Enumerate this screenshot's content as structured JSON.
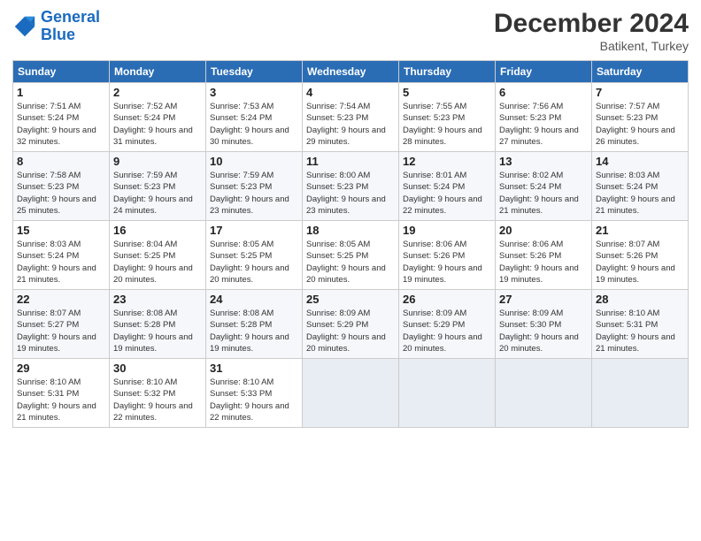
{
  "logo": {
    "line1": "General",
    "line2": "Blue"
  },
  "title": "December 2024",
  "location": "Batikent, Turkey",
  "days_header": [
    "Sunday",
    "Monday",
    "Tuesday",
    "Wednesday",
    "Thursday",
    "Friday",
    "Saturday"
  ],
  "weeks": [
    [
      {
        "day": "1",
        "sunrise": "Sunrise: 7:51 AM",
        "sunset": "Sunset: 5:24 PM",
        "daylight": "Daylight: 9 hours and 32 minutes."
      },
      {
        "day": "2",
        "sunrise": "Sunrise: 7:52 AM",
        "sunset": "Sunset: 5:24 PM",
        "daylight": "Daylight: 9 hours and 31 minutes."
      },
      {
        "day": "3",
        "sunrise": "Sunrise: 7:53 AM",
        "sunset": "Sunset: 5:24 PM",
        "daylight": "Daylight: 9 hours and 30 minutes."
      },
      {
        "day": "4",
        "sunrise": "Sunrise: 7:54 AM",
        "sunset": "Sunset: 5:23 PM",
        "daylight": "Daylight: 9 hours and 29 minutes."
      },
      {
        "day": "5",
        "sunrise": "Sunrise: 7:55 AM",
        "sunset": "Sunset: 5:23 PM",
        "daylight": "Daylight: 9 hours and 28 minutes."
      },
      {
        "day": "6",
        "sunrise": "Sunrise: 7:56 AM",
        "sunset": "Sunset: 5:23 PM",
        "daylight": "Daylight: 9 hours and 27 minutes."
      },
      {
        "day": "7",
        "sunrise": "Sunrise: 7:57 AM",
        "sunset": "Sunset: 5:23 PM",
        "daylight": "Daylight: 9 hours and 26 minutes."
      }
    ],
    [
      {
        "day": "8",
        "sunrise": "Sunrise: 7:58 AM",
        "sunset": "Sunset: 5:23 PM",
        "daylight": "Daylight: 9 hours and 25 minutes."
      },
      {
        "day": "9",
        "sunrise": "Sunrise: 7:59 AM",
        "sunset": "Sunset: 5:23 PM",
        "daylight": "Daylight: 9 hours and 24 minutes."
      },
      {
        "day": "10",
        "sunrise": "Sunrise: 7:59 AM",
        "sunset": "Sunset: 5:23 PM",
        "daylight": "Daylight: 9 hours and 23 minutes."
      },
      {
        "day": "11",
        "sunrise": "Sunrise: 8:00 AM",
        "sunset": "Sunset: 5:23 PM",
        "daylight": "Daylight: 9 hours and 23 minutes."
      },
      {
        "day": "12",
        "sunrise": "Sunrise: 8:01 AM",
        "sunset": "Sunset: 5:24 PM",
        "daylight": "Daylight: 9 hours and 22 minutes."
      },
      {
        "day": "13",
        "sunrise": "Sunrise: 8:02 AM",
        "sunset": "Sunset: 5:24 PM",
        "daylight": "Daylight: 9 hours and 21 minutes."
      },
      {
        "day": "14",
        "sunrise": "Sunrise: 8:03 AM",
        "sunset": "Sunset: 5:24 PM",
        "daylight": "Daylight: 9 hours and 21 minutes."
      }
    ],
    [
      {
        "day": "15",
        "sunrise": "Sunrise: 8:03 AM",
        "sunset": "Sunset: 5:24 PM",
        "daylight": "Daylight: 9 hours and 21 minutes."
      },
      {
        "day": "16",
        "sunrise": "Sunrise: 8:04 AM",
        "sunset": "Sunset: 5:25 PM",
        "daylight": "Daylight: 9 hours and 20 minutes."
      },
      {
        "day": "17",
        "sunrise": "Sunrise: 8:05 AM",
        "sunset": "Sunset: 5:25 PM",
        "daylight": "Daylight: 9 hours and 20 minutes."
      },
      {
        "day": "18",
        "sunrise": "Sunrise: 8:05 AM",
        "sunset": "Sunset: 5:25 PM",
        "daylight": "Daylight: 9 hours and 20 minutes."
      },
      {
        "day": "19",
        "sunrise": "Sunrise: 8:06 AM",
        "sunset": "Sunset: 5:26 PM",
        "daylight": "Daylight: 9 hours and 19 minutes."
      },
      {
        "day": "20",
        "sunrise": "Sunrise: 8:06 AM",
        "sunset": "Sunset: 5:26 PM",
        "daylight": "Daylight: 9 hours and 19 minutes."
      },
      {
        "day": "21",
        "sunrise": "Sunrise: 8:07 AM",
        "sunset": "Sunset: 5:26 PM",
        "daylight": "Daylight: 9 hours and 19 minutes."
      }
    ],
    [
      {
        "day": "22",
        "sunrise": "Sunrise: 8:07 AM",
        "sunset": "Sunset: 5:27 PM",
        "daylight": "Daylight: 9 hours and 19 minutes."
      },
      {
        "day": "23",
        "sunrise": "Sunrise: 8:08 AM",
        "sunset": "Sunset: 5:28 PM",
        "daylight": "Daylight: 9 hours and 19 minutes."
      },
      {
        "day": "24",
        "sunrise": "Sunrise: 8:08 AM",
        "sunset": "Sunset: 5:28 PM",
        "daylight": "Daylight: 9 hours and 19 minutes."
      },
      {
        "day": "25",
        "sunrise": "Sunrise: 8:09 AM",
        "sunset": "Sunset: 5:29 PM",
        "daylight": "Daylight: 9 hours and 20 minutes."
      },
      {
        "day": "26",
        "sunrise": "Sunrise: 8:09 AM",
        "sunset": "Sunset: 5:29 PM",
        "daylight": "Daylight: 9 hours and 20 minutes."
      },
      {
        "day": "27",
        "sunrise": "Sunrise: 8:09 AM",
        "sunset": "Sunset: 5:30 PM",
        "daylight": "Daylight: 9 hours and 20 minutes."
      },
      {
        "day": "28",
        "sunrise": "Sunrise: 8:10 AM",
        "sunset": "Sunset: 5:31 PM",
        "daylight": "Daylight: 9 hours and 21 minutes."
      }
    ],
    [
      {
        "day": "29",
        "sunrise": "Sunrise: 8:10 AM",
        "sunset": "Sunset: 5:31 PM",
        "daylight": "Daylight: 9 hours and 21 minutes."
      },
      {
        "day": "30",
        "sunrise": "Sunrise: 8:10 AM",
        "sunset": "Sunset: 5:32 PM",
        "daylight": "Daylight: 9 hours and 22 minutes."
      },
      {
        "day": "31",
        "sunrise": "Sunrise: 8:10 AM",
        "sunset": "Sunset: 5:33 PM",
        "daylight": "Daylight: 9 hours and 22 minutes."
      },
      null,
      null,
      null,
      null
    ]
  ]
}
